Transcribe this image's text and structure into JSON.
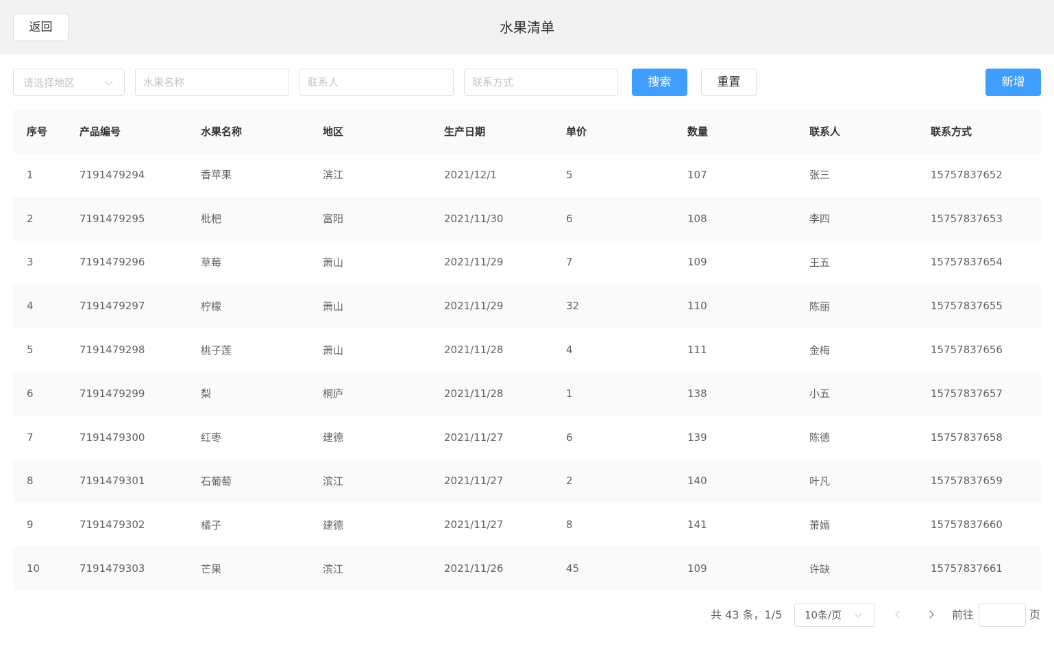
{
  "header": {
    "back_label": "返回",
    "title": "水果清单"
  },
  "filters": {
    "region_placeholder": "请选择地区",
    "fruit_name_placeholder": "水果名称",
    "contact_placeholder": "联系人",
    "phone_placeholder": "联系方式",
    "search_label": "搜索",
    "reset_label": "重置",
    "add_label": "新增"
  },
  "table": {
    "columns": [
      "序号",
      "产品编号",
      "水果名称",
      "地区",
      "生产日期",
      "单价",
      "数量",
      "联系人",
      "联系方式"
    ],
    "rows": [
      [
        "1",
        "7191479294",
        "香苹果",
        "滨江",
        "2021/12/1",
        "5",
        "107",
        "张三",
        "15757837652"
      ],
      [
        "2",
        "7191479295",
        "枇杷",
        "富阳",
        "2021/11/30",
        "6",
        "108",
        "李四",
        "15757837653"
      ],
      [
        "3",
        "7191479296",
        "草莓",
        "萧山",
        "2021/11/29",
        "7",
        "109",
        "王五",
        "15757837654"
      ],
      [
        "4",
        "7191479297",
        "柠檬",
        "萧山",
        "2021/11/29",
        "32",
        "110",
        "陈丽",
        "15757837655"
      ],
      [
        "5",
        "7191479298",
        "桃子莲",
        "萧山",
        "2021/11/28",
        "4",
        "111",
        "金梅",
        "15757837656"
      ],
      [
        "6",
        "7191479299",
        "梨",
        "桐庐",
        "2021/11/28",
        "1",
        "138",
        "小五",
        "15757837657"
      ],
      [
        "7",
        "7191479300",
        "红枣",
        "建德",
        "2021/11/27",
        "6",
        "139",
        "陈德",
        "15757837658"
      ],
      [
        "8",
        "7191479301",
        "石葡萄",
        "滨江",
        "2021/11/27",
        "2",
        "140",
        "叶凡",
        "15757837659"
      ],
      [
        "9",
        "7191479302",
        "橘子",
        "建德",
        "2021/11/27",
        "8",
        "141",
        "萧嫣",
        "15757837660"
      ],
      [
        "10",
        "7191479303",
        "芒果",
        "滨江",
        "2021/11/26",
        "45",
        "109",
        "许缺",
        "15757837661"
      ]
    ]
  },
  "pagination": {
    "total_text": "共 43 条，1/5",
    "page_size": "10条/页",
    "goto_label": "前往",
    "page_suffix": "页",
    "goto_value": ""
  }
}
